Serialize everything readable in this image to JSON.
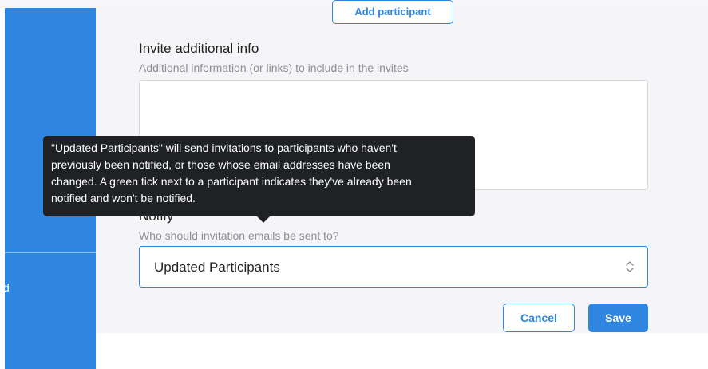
{
  "participants": {
    "add_button_label": "Add participant"
  },
  "invite_info": {
    "title": "Invite additional info",
    "description": "Additional information (or links) to include in the invites",
    "value": ""
  },
  "notify": {
    "title": "Notify",
    "description": "Who should invitation emails be sent to?",
    "selected_value": "Updated Participants",
    "chevron_icon": "chevron-up-down-icon"
  },
  "tooltip": {
    "lines": [
      "\"Updated Participants\" will send invitations to participants who haven't",
      "previously been notified, or those whose email addresses have been",
      "changed. A green tick next to a participant indicates they've already been",
      "notified and won't be notified."
    ]
  },
  "actions": {
    "cancel_label": "Cancel",
    "save_label": "Save"
  },
  "sidebar": {
    "partial_item_text": "d"
  },
  "colors": {
    "accent": "#2e86e0",
    "tooltip_bg": "#1f2124",
    "panel_bg": "#f5f5f7"
  }
}
